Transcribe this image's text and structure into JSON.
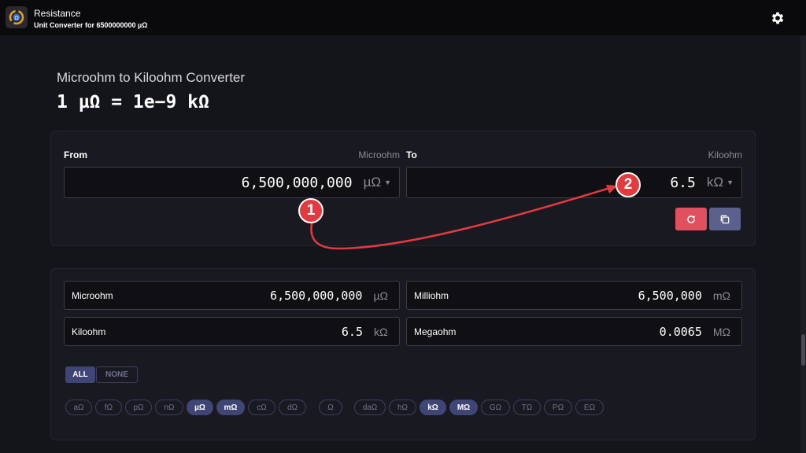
{
  "app": {
    "title": "Resistance",
    "subtitle": "Unit Converter for 6500000000 µΩ"
  },
  "page": {
    "heading": "Microohm to Kiloohm Converter",
    "equation": "1 µΩ = 1e−9 kΩ"
  },
  "from": {
    "label": "From",
    "unit_name": "Microohm",
    "value": "6,500,000,000",
    "unit": "µΩ"
  },
  "to": {
    "label": "To",
    "unit_name": "Kiloohm",
    "value": "6.5",
    "unit": "kΩ"
  },
  "results": [
    {
      "name": "Microohm",
      "value": "6,500,000,000",
      "unit": "µΩ"
    },
    {
      "name": "Milliohm",
      "value": "6,500,000",
      "unit": "mΩ"
    },
    {
      "name": "Kiloohm",
      "value": "6.5",
      "unit": "kΩ"
    },
    {
      "name": "Megaohm",
      "value": "0.0065",
      "unit": "MΩ"
    }
  ],
  "filters": {
    "all_label": "ALL",
    "none_label": "NONE"
  },
  "chips": [
    {
      "label": "aΩ",
      "active": false
    },
    {
      "label": "fΩ",
      "active": false
    },
    {
      "label": "pΩ",
      "active": false
    },
    {
      "label": "nΩ",
      "active": false
    },
    {
      "label": "µΩ",
      "active": true
    },
    {
      "label": "mΩ",
      "active": true
    },
    {
      "label": "cΩ",
      "active": false
    },
    {
      "label": "dΩ",
      "active": false
    },
    {
      "label": "Ω",
      "active": false
    },
    {
      "label": "daΩ",
      "active": false
    },
    {
      "label": "hΩ",
      "active": false
    },
    {
      "label": "kΩ",
      "active": true
    },
    {
      "label": "MΩ",
      "active": true
    },
    {
      "label": "GΩ",
      "active": false
    },
    {
      "label": "TΩ",
      "active": false
    },
    {
      "label": "PΩ",
      "active": false
    },
    {
      "label": "EΩ",
      "active": false
    }
  ],
  "annotations": {
    "marker_1": "1",
    "marker_2": "2",
    "color": "#e23a3f"
  },
  "icons": {
    "app": "resistance-app-icon",
    "settings": "gear-icon",
    "reset": "reset-icon",
    "copy": "copy-icon"
  },
  "colors": {
    "background": "#14151b",
    "accent": "#3f4676",
    "reset_button": "#e0505e",
    "copy_button": "#5b618c"
  }
}
